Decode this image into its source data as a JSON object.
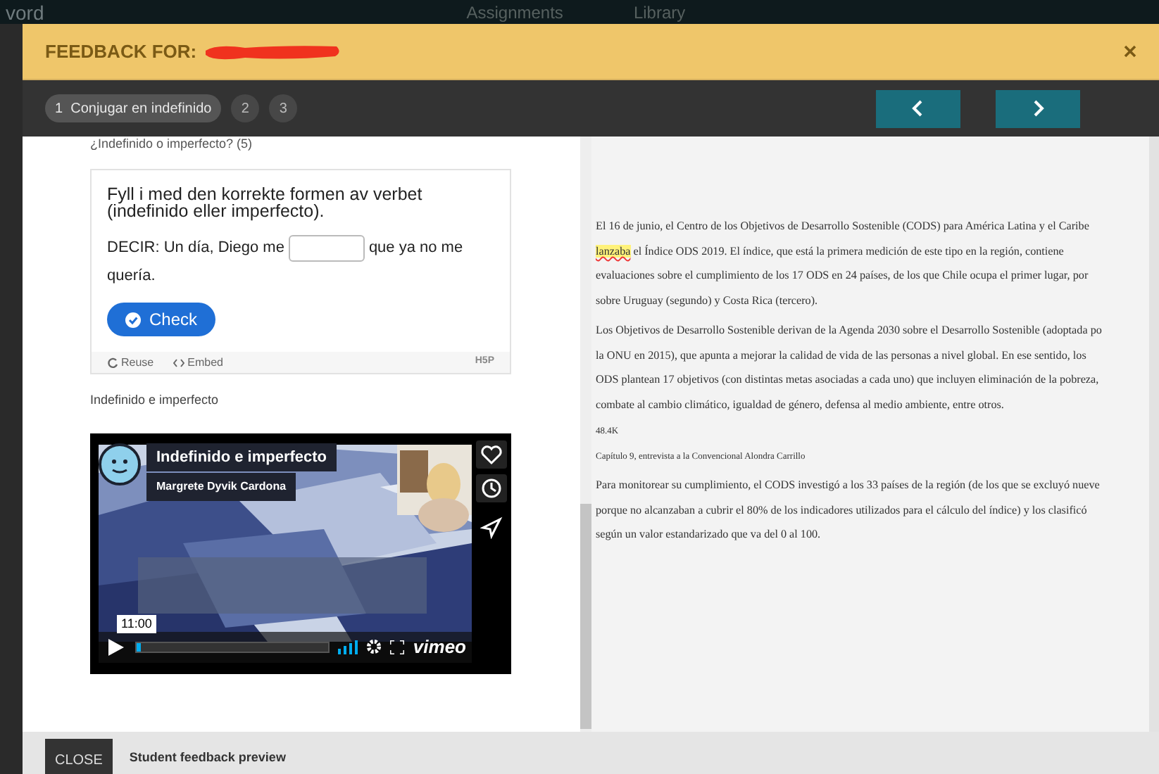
{
  "background_header": {
    "logo": "vord",
    "nav": [
      "Assignments",
      "Library"
    ]
  },
  "modal": {
    "title": "FEEDBACK FOR:",
    "redacted": true,
    "steps": [
      {
        "label": "1  Conjugar en indefinido",
        "selected": true
      },
      {
        "label": "2",
        "selected": false
      },
      {
        "label": "3",
        "selected": false
      }
    ],
    "nav_buttons": [
      {
        "kind": "prev"
      },
      {
        "kind": "next"
      }
    ],
    "left": {
      "heading": "¿Indefinido o imperfecto? (5)",
      "exercise": {
        "instruction": "Fyll i med den korrekte formen av verbet (indefinido eller imperfecto).",
        "before": "DECIR: Un día, Diego me",
        "after": [
          "que ya no me",
          "quería."
        ],
        "button": "Check",
        "footer": [
          "Reuse",
          "Embed"
        ],
        "brand": "H5P"
      },
      "video_caption": "Indefinido e imperfecto",
      "video": {
        "kind": "picture",
        "title": "Indefinido e imperfecto",
        "author": "Margrete Dyvik Cardona",
        "time": "11:00",
        "level": 0.02,
        "brand": "vimeo"
      }
    },
    "right": {
      "paragraphs": [
        {
          "kind": "body",
          "lines": [
            [
              {
                "text": "El 16 de junio, el Centro de los Objetivos de Desarrollo Sostenible (CODS) para América Latina y el Caribe",
                "highlighted": false
              }
            ],
            [
              {
                "text": "lanzaba",
                "highlighted": true
              },
              {
                "text": " el Índice ODS 2019. El índice, que está la primera medición de este tipo en la región, contiene",
                "highlighted": false
              }
            ],
            [
              {
                "text": "evaluaciones sobre el cumplimiento de los 17 ODS en 24 países, de los que Chile ocupa el primer lugar, por",
                "highlighted": false
              }
            ],
            [
              {
                "text": "sobre Uruguay (segundo) y Costa Rica (tercero).",
                "highlighted": false
              }
            ]
          ]
        },
        {
          "kind": "body",
          "lines": [
            [
              {
                "text": "Los Objetivos de Desarrollo Sostenible derivan de la Agenda 2030 sobre el Desarrollo Sostenible (adoptada po",
                "highlighted": false
              }
            ],
            [
              {
                "text": "la ONU en 2015), que apunta a mejorar la calidad de vida de las personas a nivel global. En ese sentido, los",
                "highlighted": false
              }
            ],
            [
              {
                "text": "ODS plantean 17 objetivos (con distintas metas asociadas a cada uno) que incluyen eliminación de la pobreza,",
                "highlighted": false
              }
            ],
            [
              {
                "text": "combate al cambio climático, igualdad de género, defensa al medio ambiente, entre otros.",
                "highlighted": false
              }
            ]
          ]
        },
        {
          "kind": "small",
          "lines": [
            [
              {
                "text": "48.4K",
                "highlighted": false
              }
            ]
          ]
        },
        {
          "kind": "small",
          "lines": [
            [
              {
                "text": "Capítulo 9, entrevista a la Convencional Alondra Carrillo",
                "highlighted": false
              }
            ]
          ]
        },
        {
          "kind": "body",
          "lines": [
            [
              {
                "text": "Para monitorear su cumplimiento, el CODS investigó a los 33 países de la región (de los que se excluyó nueve",
                "highlighted": false
              }
            ],
            [
              {
                "text": "porque no alcanzaban a cubrir el 80% de los indicadores utilizados para el cálculo del índice) y los clasificó",
                "highlighted": false
              }
            ],
            [
              {
                "text": "según un valor estandarizado que va del 0 al 100.",
                "highlighted": false
              }
            ]
          ]
        }
      ]
    },
    "footer": {
      "button": "CLOSE",
      "label": "Student feedback preview"
    }
  }
}
